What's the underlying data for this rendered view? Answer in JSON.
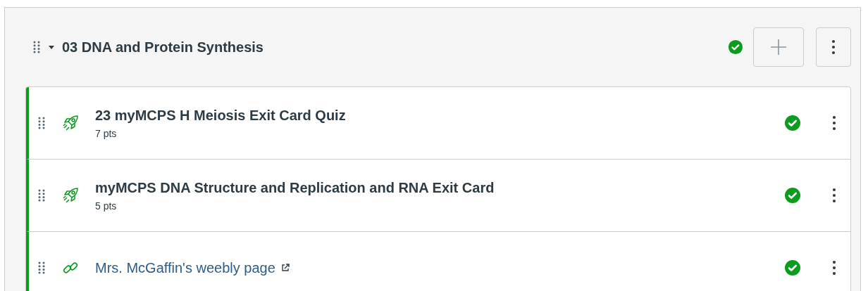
{
  "module": {
    "title": "03 DNA and Protein Synthesis",
    "expanded": true,
    "published": true,
    "items": [
      {
        "kind": "quiz",
        "title": "23 myMCPS H Meiosis Exit Card Quiz",
        "points": "7 pts",
        "published": true
      },
      {
        "kind": "quiz",
        "title": "myMCPS DNA Structure and Replication and RNA Exit Card",
        "points": "5 pts",
        "published": true
      },
      {
        "kind": "link",
        "title": "Mrs. McGaffin's weebly page",
        "published": true
      }
    ]
  }
}
